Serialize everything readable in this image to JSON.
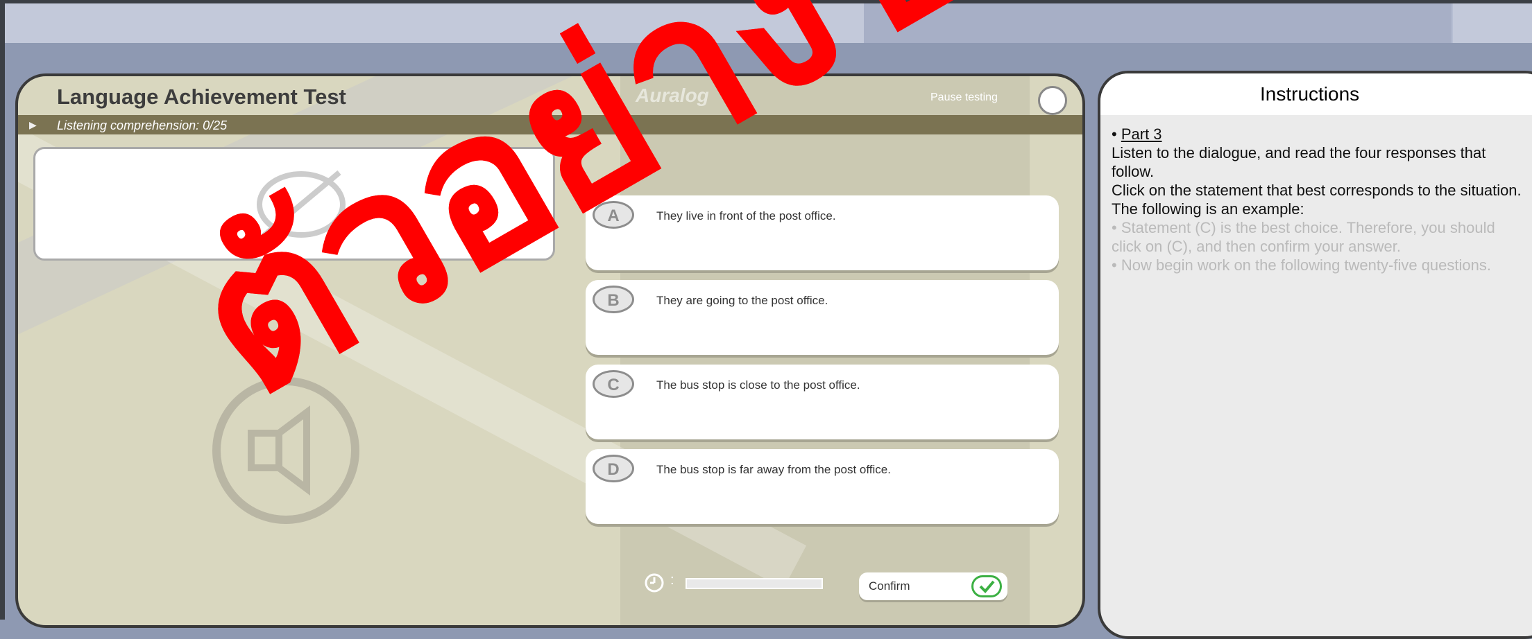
{
  "test": {
    "title": "Language Achievement Test",
    "brand": "Auralog",
    "pause_label": "Pause testing",
    "section_label": "Listening comprehension: 0/25"
  },
  "options": [
    {
      "letter": "A",
      "text": "They live in front of the post office."
    },
    {
      "letter": "B",
      "text": "They are going to the post office."
    },
    {
      "letter": "C",
      "text": "The bus stop is close to the post office."
    },
    {
      "letter": "D",
      "text": "The bus stop is far away from the post office."
    }
  ],
  "timer": {
    "colon": ":"
  },
  "confirm": {
    "label": "Confirm"
  },
  "instructions": {
    "title": "Instructions",
    "bullet": "•",
    "part_label": "Part 3",
    "lines": [
      "Listen to the dialogue, and read the four responses that follow.",
      "Click on the statement that best corresponds to the situation.",
      "The following is an example:"
    ],
    "faded_lines": [
      "• Statement (C) is the best choice. Therefore, you should click on (C), and then confirm your answer.",
      "• Now begin work on the following twenty-five questions."
    ]
  },
  "watermark": {
    "text": "ตัวอย่างข้อสอบ"
  },
  "colors": {
    "panel_bg": "#d9d7bf",
    "section_bar": "#7b7352",
    "confirm_check": "#3cb043",
    "watermark": "#ff0000"
  }
}
